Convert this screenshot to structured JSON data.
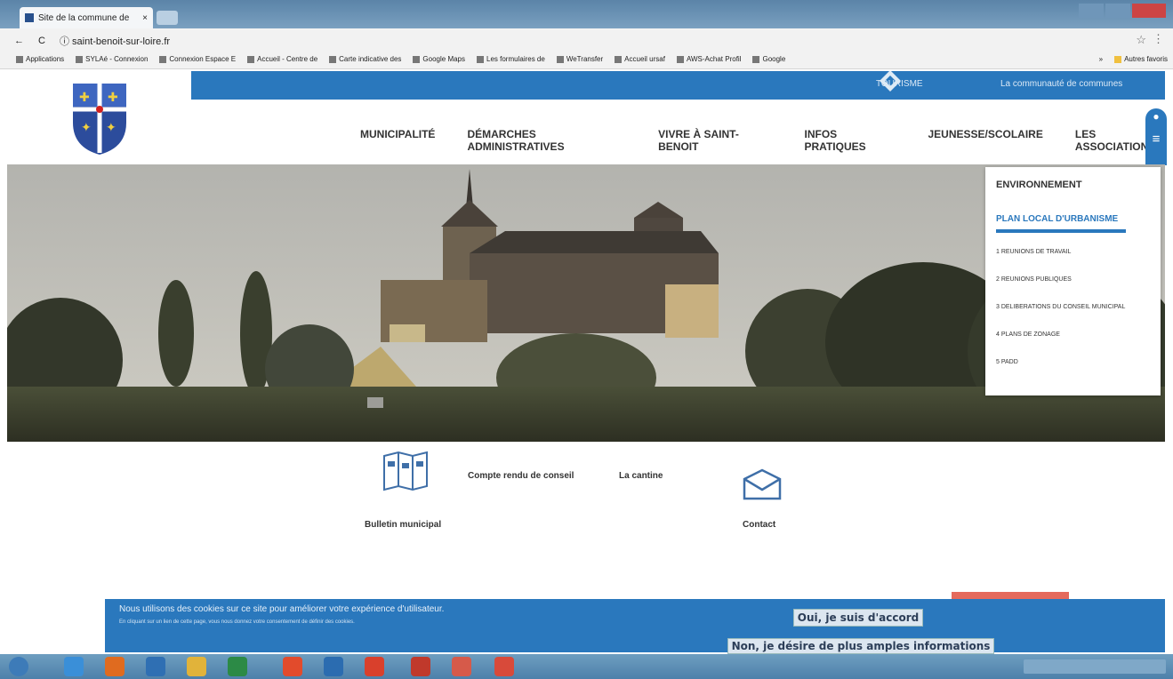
{
  "browser": {
    "tab_title": "Site de la commune de",
    "tab_close": "×",
    "back": "←",
    "reload": "C",
    "url": "ⓘ saint-benoit-sur-loire.fr",
    "star": "☆",
    "menu": "⋮",
    "bookmarks": [
      "Applications",
      "SYLAé - Connexion",
      "Connexion Espace E",
      "Accueil - Centre de",
      "Carte indicative des",
      "Google Maps",
      "Les formulaires de",
      "WeTransfer",
      "Accueil ursaf",
      "AWS-Achat Profil",
      "Google"
    ],
    "more_bookmarks": "»",
    "other_bookmarks": "Autres favoris"
  },
  "site": {
    "tourism_link": "TOURISME",
    "community_link": "La communauté de communes",
    "nav": [
      "MUNICIPALITÉ",
      "DÉMARCHES ADMINISTRATIVES",
      "VIVRE À SAINT-BENOIT",
      "INFOS PRATIQUES",
      "JEUNESSE/SCOLAIRE",
      "LES ASSOCIATIONS"
    ],
    "dropdown": {
      "title": "ENVIRONNEMENT",
      "subtitle": "PLAN LOCAL D'URBANISME",
      "items": [
        "1  REUNIONS DE TRAVAIL",
        "2  REUNIONS PUBLIQUES",
        "3  DELIBERATIONS DU CONSEIL MUNICIPAL",
        "4  PLANS DE ZONAGE",
        "5  PADD"
      ]
    },
    "quick_links": {
      "bulletin": "Bulletin municipal",
      "compte_rendu": "Compte rendu de conseil",
      "cantine": "La cantine",
      "contact": "Contact"
    }
  },
  "cookie": {
    "message": "Nous utilisons des cookies sur ce site pour améliorer votre expérience d'utilisateur.",
    "detail": "En cliquant sur un lien de cette page, vous nous donnez votre consentement de définir des cookies.",
    "accept": "Oui, je suis d'accord",
    "more": "Non, je désire de plus amples informations"
  },
  "colors": {
    "brand_blue": "#2a78bd",
    "accent": "#e56a5c"
  }
}
